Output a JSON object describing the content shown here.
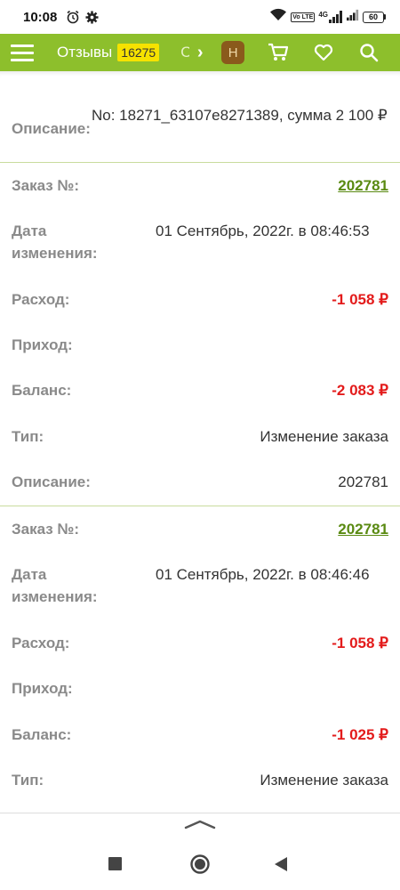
{
  "status_bar": {
    "time": "10:08",
    "net_badge": "Vo LTE",
    "network": "4G",
    "battery": "60"
  },
  "header": {
    "reviews_label": "Отзывы",
    "reviews_count": "16275",
    "truncated_text": "О",
    "next_arrow": "›",
    "user_initial": "Н"
  },
  "top_entry": {
    "description_label": "Описание:",
    "description_value": "No: 18271_63107e8271389, сумма 2 100 ₽"
  },
  "entries": [
    {
      "order_label": "Заказ №:",
      "order_number": "202781",
      "date_label": "Дата изменения:",
      "date_value": "01 Сентябрь, 2022г. в 08:46:53",
      "expense_label": "Расход:",
      "expense_value": "-1 058 ₽",
      "income_label": "Приход:",
      "income_value": "",
      "balance_label": "Баланс:",
      "balance_value": "-2 083 ₽",
      "type_label": "Тип:",
      "type_value": "Изменение заказа",
      "description_label": "Описание:",
      "description_value": "202781"
    },
    {
      "order_label": "Заказ №:",
      "order_number": "202781",
      "date_label": "Дата изменения:",
      "date_value": "01 Сентябрь, 2022г. в 08:46:46",
      "expense_label": "Расход:",
      "expense_value": "-1 058 ₽",
      "income_label": "Приход:",
      "income_value": "",
      "balance_label": "Баланс:",
      "balance_value": "-1 025 ₽",
      "type_label": "Тип:",
      "type_value": "Изменение заказа"
    }
  ],
  "colors": {
    "header_bg": "#8dbf2c",
    "count_badge_bg": "#f6e200",
    "negative": "#e31b1b",
    "link": "#5a8a12",
    "label": "#8a8a8a"
  }
}
